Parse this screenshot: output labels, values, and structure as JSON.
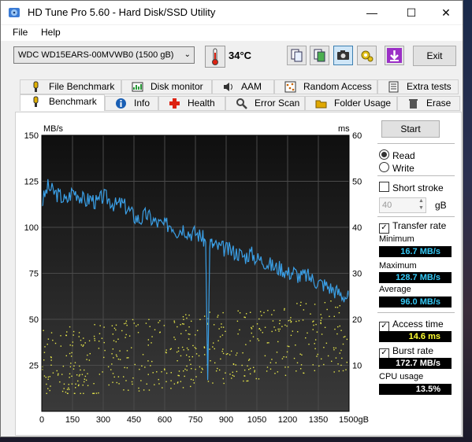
{
  "window": {
    "title": "HD Tune Pro 5.60 - Hard Disk/SSD Utility"
  },
  "menu": [
    "File",
    "Help"
  ],
  "toolbar": {
    "drive": "WDC WD15EARS-00MVWB0 (1500 gB)",
    "temperature": "34°C",
    "exit_label": "Exit"
  },
  "tabs_row1": [
    {
      "label": "File Benchmark",
      "icon": "file-benchmark-icon"
    },
    {
      "label": "Disk monitor",
      "icon": "disk-monitor-icon"
    },
    {
      "label": "AAM",
      "icon": "speaker-icon"
    },
    {
      "label": "Random Access",
      "icon": "random-access-icon"
    },
    {
      "label": "Extra tests",
      "icon": "extra-tests-icon"
    }
  ],
  "tabs_row2": [
    {
      "label": "Benchmark",
      "icon": "benchmark-icon",
      "active": true
    },
    {
      "label": "Info",
      "icon": "info-icon"
    },
    {
      "label": "Health",
      "icon": "health-cross-icon"
    },
    {
      "label": "Error Scan",
      "icon": "magnifier-icon"
    },
    {
      "label": "Folder Usage",
      "icon": "folder-icon"
    },
    {
      "label": "Erase",
      "icon": "trash-icon"
    }
  ],
  "side": {
    "start_label": "Start",
    "read_label": "Read",
    "write_label": "Write",
    "short_stroke_label": "Short stroke",
    "stroke_value": "40",
    "stroke_unit": "gB",
    "transfer_rate_label": "Transfer rate",
    "minimum_label": "Minimum",
    "minimum_value": "16.7 MB/s",
    "maximum_label": "Maximum",
    "maximum_value": "128.7 MB/s",
    "average_label": "Average",
    "average_value": "96.0 MB/s",
    "access_time_label": "Access time",
    "access_time_value": "14.6 ms",
    "burst_rate_label": "Burst rate",
    "burst_rate_value": "172.7 MB/s",
    "cpu_label": "CPU usage",
    "cpu_value": "13.5%"
  },
  "colors": {
    "transfer": "#3a9fe6",
    "access": "#e8e84a",
    "plot_bg": "#1e1e1e"
  },
  "chart_data": {
    "type": "line",
    "y_left_label": "MB/s",
    "y_right_label": "ms",
    "y_left_ticks": [
      "150",
      "125",
      "100",
      "75",
      "50",
      "25"
    ],
    "y_right_ticks": [
      "60",
      "50",
      "40",
      "30",
      "20",
      "10"
    ],
    "x_ticks": [
      "0",
      "150",
      "300",
      "450",
      "600",
      "750",
      "900",
      "1050",
      "1200",
      "1350",
      "1500gB"
    ],
    "xlim": [
      0,
      1500
    ],
    "ylim_left": [
      0,
      150
    ],
    "ylim_right": [
      0,
      60
    ],
    "series": [
      {
        "type": "line",
        "x": [
          0,
          30,
          60,
          90,
          120,
          150,
          180,
          210,
          240,
          270,
          300,
          330,
          360,
          390,
          420,
          450,
          480,
          510,
          540,
          570,
          600,
          630,
          660,
          690,
          720,
          750,
          780,
          800,
          810,
          820,
          840,
          870,
          900,
          930,
          960,
          990,
          1020,
          1050,
          1080,
          1110,
          1140,
          1170,
          1200,
          1230,
          1260,
          1290,
          1320,
          1350,
          1380,
          1410,
          1440,
          1470,
          1500
        ],
        "values": [
          113,
          122,
          119,
          117,
          114,
          120,
          118,
          114,
          116,
          113,
          117,
          115,
          112,
          113,
          110,
          106,
          104,
          107,
          104,
          102,
          101,
          102,
          98,
          100,
          97,
          97,
          95,
          92,
          17,
          92,
          90,
          89,
          88,
          87,
          86,
          84,
          86,
          83,
          82,
          80,
          78,
          78,
          75,
          76,
          73,
          74,
          72,
          70,
          69,
          67,
          65,
          63,
          62
        ]
      },
      {
        "type": "scatter",
        "y_axis": "right",
        "x_range": [
          0,
          1500
        ],
        "y_range": [
          4,
          25
        ],
        "mean_ms": 14.6
      }
    ]
  }
}
